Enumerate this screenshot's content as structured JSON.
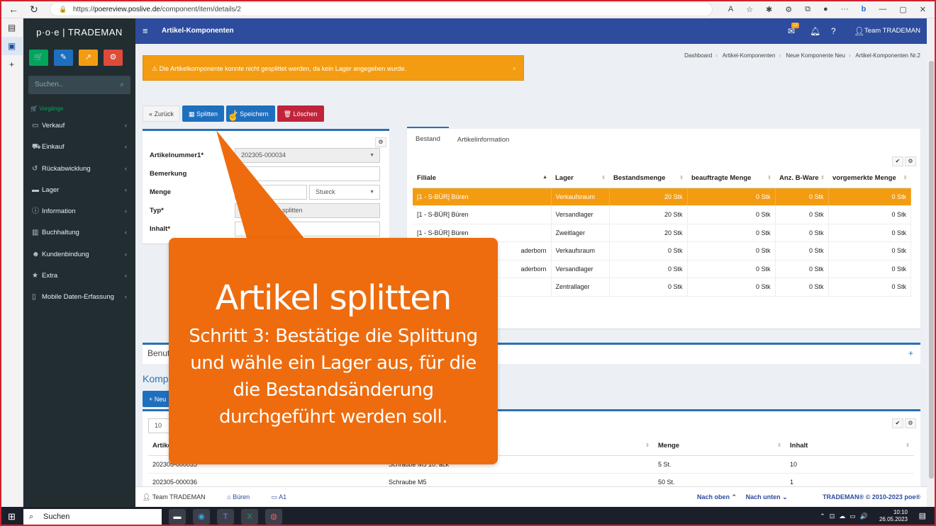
{
  "browser": {
    "url_prefix": "https://",
    "url_host": "poereview.poslive.de",
    "url_path": "/component/item/details/2"
  },
  "sidebar": {
    "logo": "p·o·e | TRADEMAN",
    "search_placeholder": "Suchen..",
    "section": "Vorgänge",
    "items": [
      {
        "label": "Verkauf",
        "icon": "monitor-icon"
      },
      {
        "label": "Einkauf",
        "icon": "cart-icon"
      },
      {
        "label": "Rückabwicklung",
        "icon": "undo-icon"
      },
      {
        "label": "Lager",
        "icon": "truck-icon"
      },
      {
        "label": "Information",
        "icon": "info-icon"
      },
      {
        "label": "Buchhaltung",
        "icon": "bank-icon"
      },
      {
        "label": "Kundenbindung",
        "icon": "users-icon"
      },
      {
        "label": "Extra",
        "icon": "star-icon"
      },
      {
        "label": "Mobile Daten-Erfassung",
        "icon": "mobile-icon"
      }
    ],
    "quick_colors": [
      "#00a65a",
      "#1f6fbf",
      "#f39c12",
      "#dd4b39"
    ]
  },
  "topbar": {
    "title": "Artikel-Komponenten",
    "mail_badge": "13",
    "user": "Team TRADEMAN"
  },
  "alert": {
    "text": "Die Artikelkomponente konnte nicht gesplittet werden, da kein Lager angegeben wurde.",
    "close": "×"
  },
  "breadcrumb": [
    "Dashboard",
    "Artikel-Komponenten",
    "Neue Komponente Neu",
    "Artikel-Komponenten Nr.2"
  ],
  "buttons": {
    "back": "« Zurück",
    "split": "Splitten",
    "save": "Speichern",
    "delete": "Löschen"
  },
  "form": {
    "article_label": "Artikelnummer1*",
    "article_value": "202305-000034",
    "remark_label": "Bemerkung",
    "qty_label": "Menge",
    "unit_value": "Stueck",
    "type_label": "Typ*",
    "type_value": "splitten",
    "content_label": "Inhalt*"
  },
  "stock": {
    "tabs": [
      "Bestand",
      "Artikelinformation"
    ],
    "columns": [
      "Filiale",
      "Lager",
      "Bestandsmenge",
      "beauftragte Menge",
      "Anz. B-Ware",
      "vorgemerkte Menge"
    ],
    "rows": [
      [
        "[1 - S-BÜR] Büren",
        "Verkaufsraum",
        "20 Stk",
        "0 Stk",
        "0 Stk",
        "0 Stk"
      ],
      [
        "[1 - S-BÜR] Büren",
        "Versandlager",
        "20 Stk",
        "0 Stk",
        "0 Stk",
        "0 Stk"
      ],
      [
        "[1 - S-BÜR] Büren",
        "Zweitlager",
        "20 Stk",
        "0 Stk",
        "0 Stk",
        "0 Stk"
      ],
      [
        "aderborn",
        "Verkaufsraum",
        "0 Stk",
        "0 Stk",
        "0 Stk",
        "0 Stk"
      ],
      [
        "aderborn",
        "Versandlager",
        "0 Stk",
        "0 Stk",
        "0 Stk",
        "0 Stk"
      ],
      [
        "",
        "Zentrallager",
        "0 Stk",
        "0 Stk",
        "0 Stk",
        "0 Stk"
      ]
    ]
  },
  "sections": {
    "user_box": "Benutz",
    "components_title": "Kompo",
    "new_button": "+ Neu",
    "page_size": "10",
    "comp_columns": [
      "Artikeln",
      "Menge",
      "Inhalt"
    ],
    "comp_rows": [
      [
        "202305-000035",
        "Schraube M5 10. ack",
        "5 St.",
        "10"
      ],
      [
        "202305-000036",
        "Schraube M5",
        "50 St.",
        "1"
      ]
    ]
  },
  "footer": {
    "user": "Team TRADEMAN",
    "branch": "Büren",
    "register": "A1",
    "up": "Nach oben ⌃",
    "down": "Nach unten ⌄",
    "copyright": "TRADEMAN® © 2010-2023 poe®"
  },
  "callout": {
    "title": "Artikel splitten",
    "body": "Schritt 3: Bestätige die Splittung und wähle ein Lager aus, für die die Bestandsänderung durchgeführt werden soll."
  },
  "taskbar": {
    "search": "Suchen",
    "time": "10:10",
    "date": "26.05.2023"
  }
}
